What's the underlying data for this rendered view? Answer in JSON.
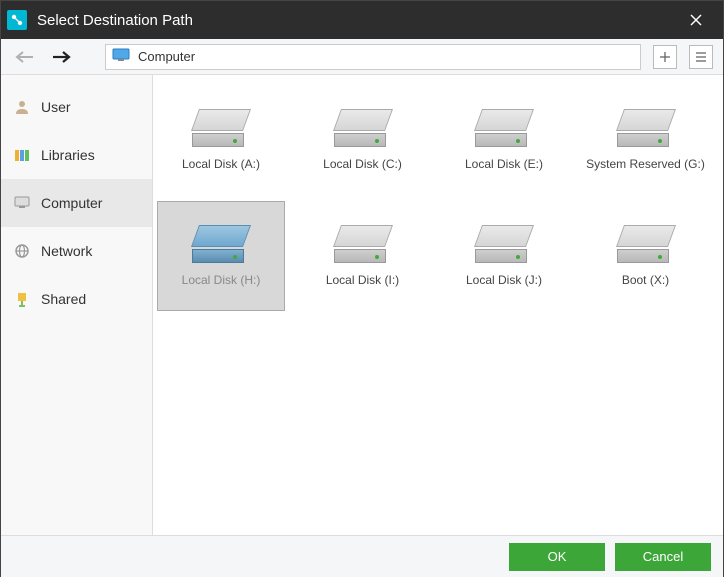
{
  "window": {
    "title": "Select Destination Path"
  },
  "path": {
    "label": "Computer"
  },
  "sidebar": {
    "items": [
      {
        "label": "User"
      },
      {
        "label": "Libraries"
      },
      {
        "label": "Computer"
      },
      {
        "label": "Network"
      },
      {
        "label": "Shared"
      }
    ]
  },
  "drives": [
    {
      "label": "Local Disk (A:)"
    },
    {
      "label": "Local Disk (C:)"
    },
    {
      "label": "Local Disk (E:)"
    },
    {
      "label": "System Reserved (G:)"
    },
    {
      "label": "Local Disk (H:)"
    },
    {
      "label": "Local Disk (I:)"
    },
    {
      "label": "Local Disk (J:)"
    },
    {
      "label": "Boot (X:)"
    }
  ],
  "footer": {
    "ok": "OK",
    "cancel": "Cancel"
  }
}
